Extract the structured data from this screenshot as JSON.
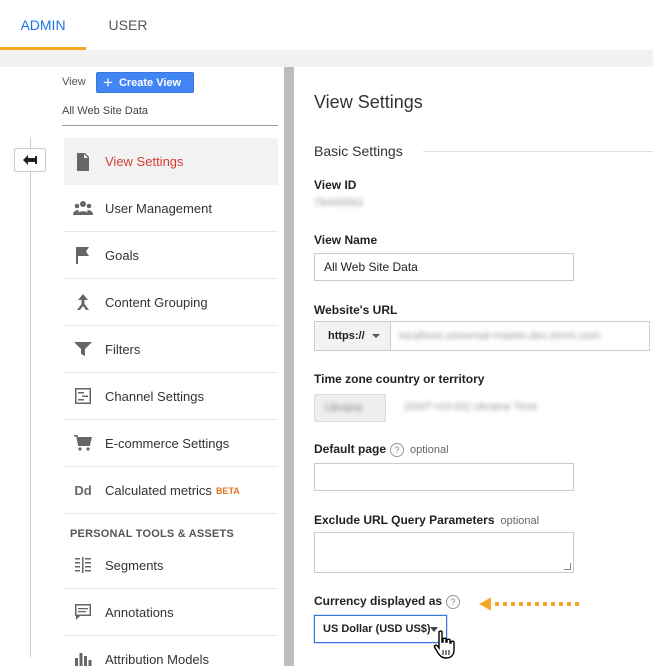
{
  "tabs": [
    {
      "label": "ADMIN",
      "active": true
    },
    {
      "label": "USER",
      "active": false
    }
  ],
  "left": {
    "view_label": "View",
    "create_view_label": "Create View",
    "selected_view": "All Web Site Data",
    "menu": [
      {
        "label": "View Settings",
        "icon": "document-icon",
        "active": true
      },
      {
        "label": "User Management",
        "icon": "users-icon"
      },
      {
        "label": "Goals",
        "icon": "flag-icon"
      },
      {
        "label": "Content Grouping",
        "icon": "content-grouping-icon"
      },
      {
        "label": "Filters",
        "icon": "filter-icon"
      },
      {
        "label": "Channel Settings",
        "icon": "channel-settings-icon"
      },
      {
        "label": "E-commerce Settings",
        "icon": "cart-icon"
      },
      {
        "label": "Calculated metrics",
        "icon": "dd-icon",
        "icon_text": "Dd",
        "badge": "BETA"
      }
    ],
    "section_header": "PERSONAL TOOLS & ASSETS",
    "tools": [
      {
        "label": "Segments",
        "icon": "segments-icon"
      },
      {
        "label": "Annotations",
        "icon": "annotations-icon"
      },
      {
        "label": "Attribution Models",
        "icon": "bar-chart-icon"
      }
    ]
  },
  "main": {
    "title": "View Settings",
    "section_title": "Basic Settings",
    "view_id_label": "View ID",
    "view_id_value": "78449563",
    "view_name_label": "View Name",
    "view_name_value": "All Web Site Data",
    "url_label": "Website's URL",
    "url_protocol": "https://",
    "url_value": "localhost.universal-master.dev.zinrm.com",
    "timezone_label": "Time zone country or territory",
    "timezone_country": "Ukraine",
    "timezone_value": "(GMT+03:00) Ukraine Time",
    "default_page_label": "Default page",
    "optional_text": "optional",
    "default_page_value": "",
    "exclude_label": "Exclude URL Query Parameters",
    "exclude_optional_text": "optional",
    "currency_label": "Currency displayed as",
    "currency_value": "US Dollar (USD US$)",
    "help_glyph": "?"
  },
  "colors": {
    "accent_blue": "#1a73e8",
    "active_red": "#d23f31",
    "tab_underline": "#f5a623",
    "arrow_orange": "#f5a623",
    "beta_orange": "#e8711c"
  }
}
